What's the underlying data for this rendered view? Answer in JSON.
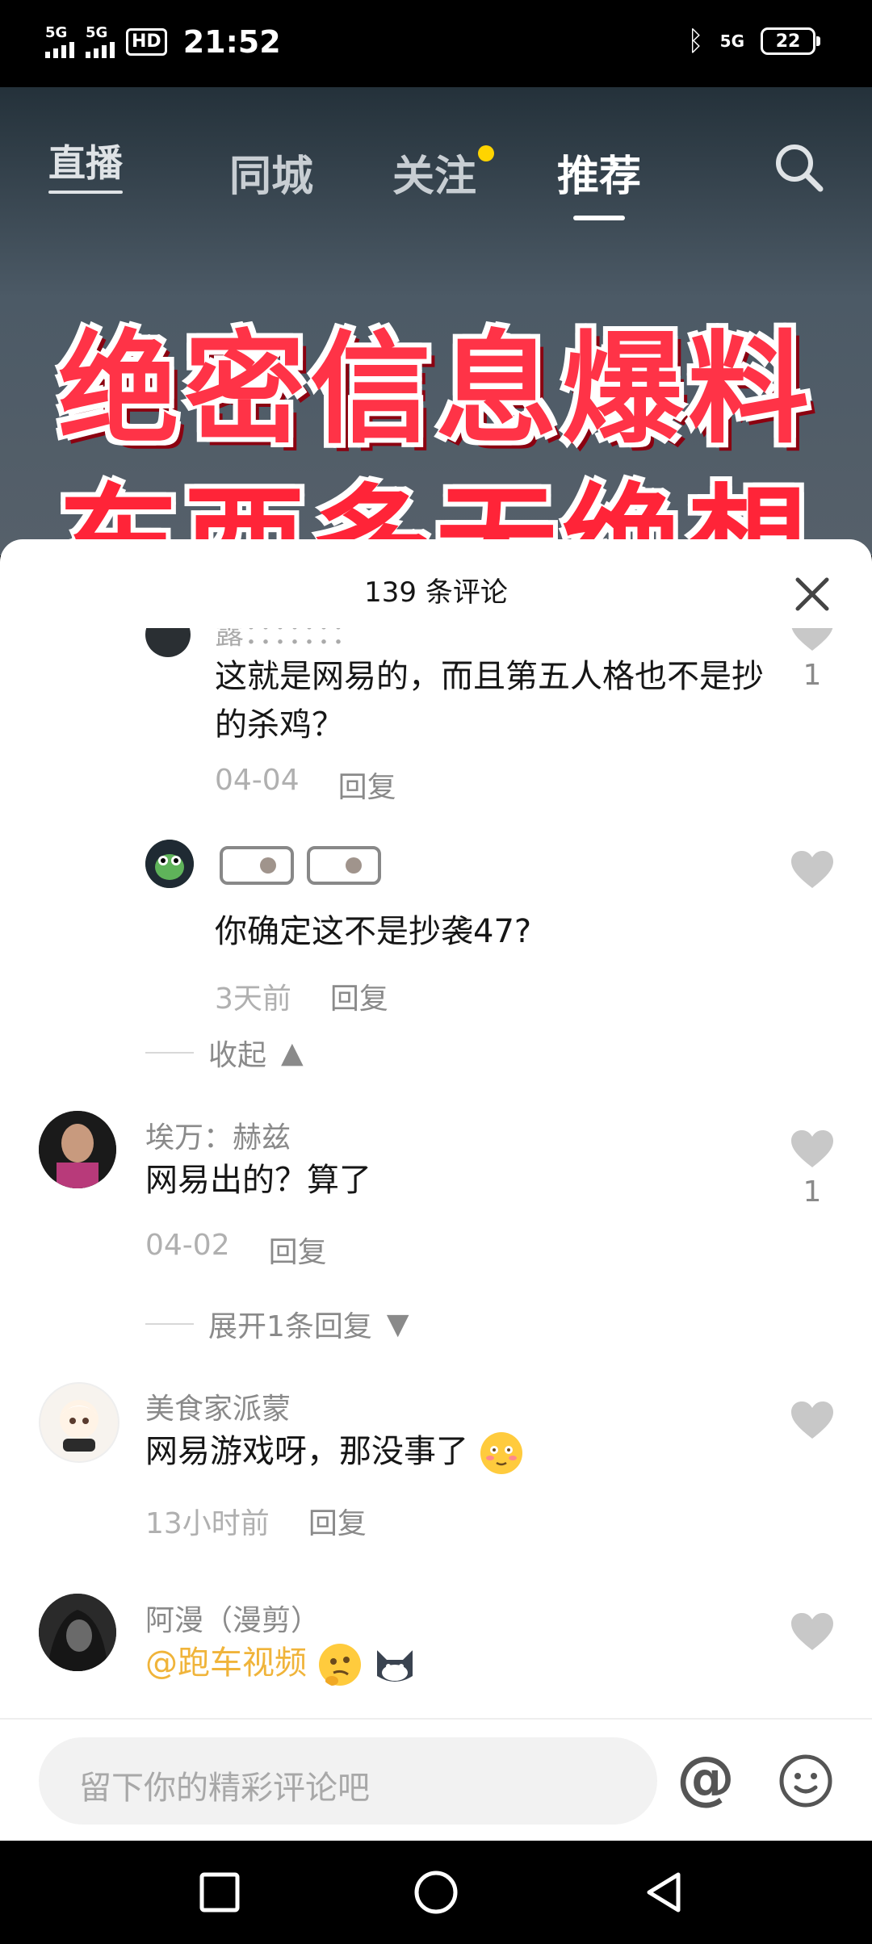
{
  "status_bar": {
    "network_left_1": "5G",
    "network_left_2": "5G",
    "hd_badge": "HD",
    "time": "21:52",
    "network_right": "5G",
    "battery": "22"
  },
  "top_nav": {
    "live": "直播",
    "tabs": [
      "同城",
      "关注",
      "推荐"
    ],
    "active_tab": "推荐"
  },
  "video": {
    "banner_line1": "绝密信息爆料",
    "banner_line2": "东西多无绝想多"
  },
  "comments_sheet": {
    "title": "139 条评论",
    "comments": [
      {
        "username": "露：：：：：：：",
        "text": "这就是网易的，而且第五人格也不是抄的杀鸡？",
        "date": "04-04",
        "reply": "回复",
        "likes": "1"
      },
      {
        "username": "",
        "text": "你确定这不是抄袭47?",
        "date": "3天前",
        "reply": "回复",
        "likes": ""
      },
      {
        "username": "埃万：赫兹",
        "text": "网易出的？算了",
        "date": "04-02",
        "reply": "回复",
        "likes": "1"
      },
      {
        "username": "美食家派蒙",
        "text": "网易游戏呀，那没事了",
        "date": "13小时前",
        "reply": "回复",
        "likes": ""
      },
      {
        "username": "阿漫（漫剪）",
        "text": "@跑车视频",
        "date": "",
        "reply": "",
        "likes": ""
      }
    ],
    "collapse_label": "收起",
    "expand_label": "展开1条回复"
  },
  "input_bar": {
    "placeholder": "留下你的精彩评论吧",
    "at_symbol": "@"
  },
  "colors": {
    "accent": "#f0b43a",
    "like_gray": "#c8c8c8"
  },
  "icons": [
    "search-icon",
    "close-icon",
    "heart-icon",
    "at-icon",
    "smile-icon",
    "square-icon",
    "circle-icon",
    "back-icon",
    "bluetooth-icon",
    "battery-icon"
  ]
}
